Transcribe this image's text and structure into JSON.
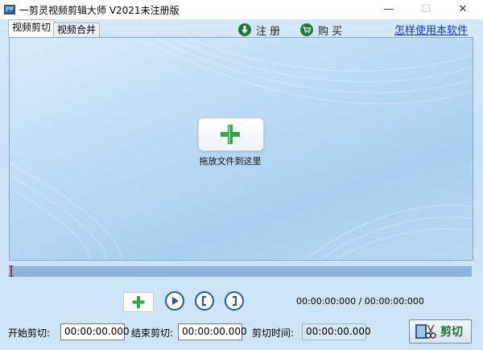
{
  "window": {
    "title": "一剪灵视频剪辑大师 V2021未注册版",
    "minimize": "—",
    "maximize": "☐",
    "close": "✕"
  },
  "tabs": [
    {
      "label": "视频剪切"
    },
    {
      "label": "视频合并"
    }
  ],
  "toolbar": {
    "register_label": "注 册",
    "buy_label": "购 买",
    "help_link": "怎样使用本软件"
  },
  "canvas": {
    "drop_label": "拖放文件到这里"
  },
  "player": {
    "time_display": "00:00:00:000 / 00:00:00:000"
  },
  "cut": {
    "start_label": "开始剪切:",
    "start_value": "00:00:00.000",
    "end_label": "结束剪切:",
    "end_value": "00:00:00.000",
    "duration_label": "剪切时间:",
    "duration_value": "00:00:00.000",
    "button_label": "剪切"
  },
  "colors": {
    "accent": "#1e5d9a",
    "green": "#1f9a35",
    "link": "#0b36c8"
  }
}
